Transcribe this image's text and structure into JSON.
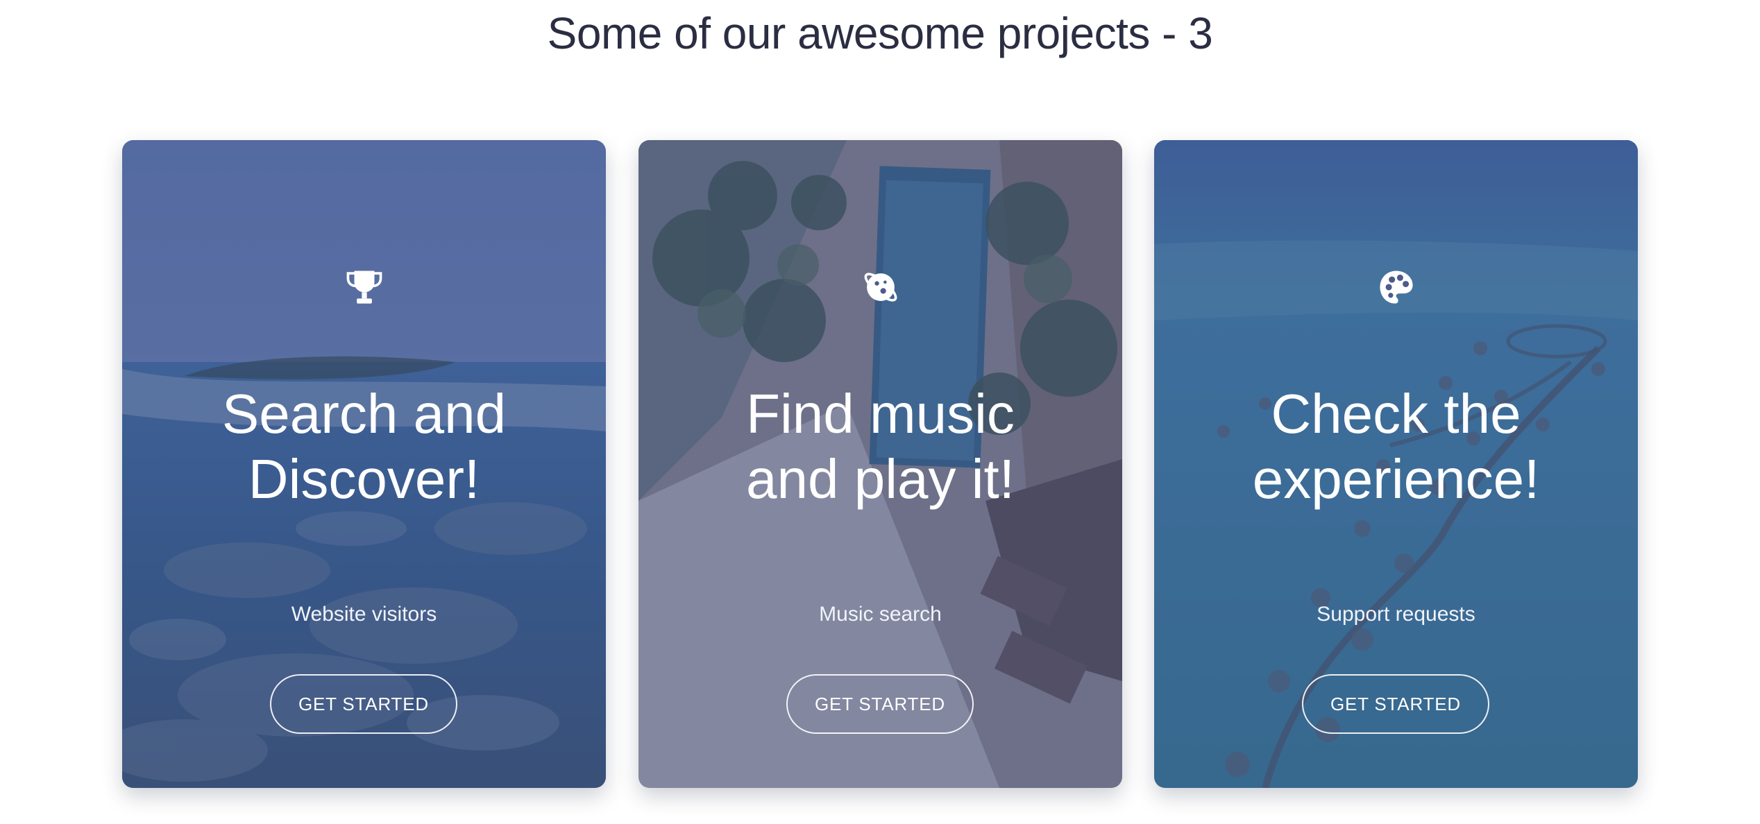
{
  "section": {
    "title": "Some of our awesome projects - 3"
  },
  "cards": [
    {
      "icon": "trophy-icon",
      "title_line1": "Search and",
      "title_line2": "Discover!",
      "subtitle": "Website visitors",
      "button_label": "GET STARTED"
    },
    {
      "icon": "planet-icon",
      "title_line1": "Find music",
      "title_line2": "and play it!",
      "subtitle": "Music search",
      "button_label": "GET STARTED"
    },
    {
      "icon": "palette-icon",
      "title_line1": "Check the",
      "title_line2": "experience!",
      "subtitle": "Support requests",
      "button_label": "GET STARTED"
    }
  ],
  "colors": {
    "heading": "#2b2d42",
    "overlay": "#3e4880",
    "card_text": "#ffffff"
  }
}
